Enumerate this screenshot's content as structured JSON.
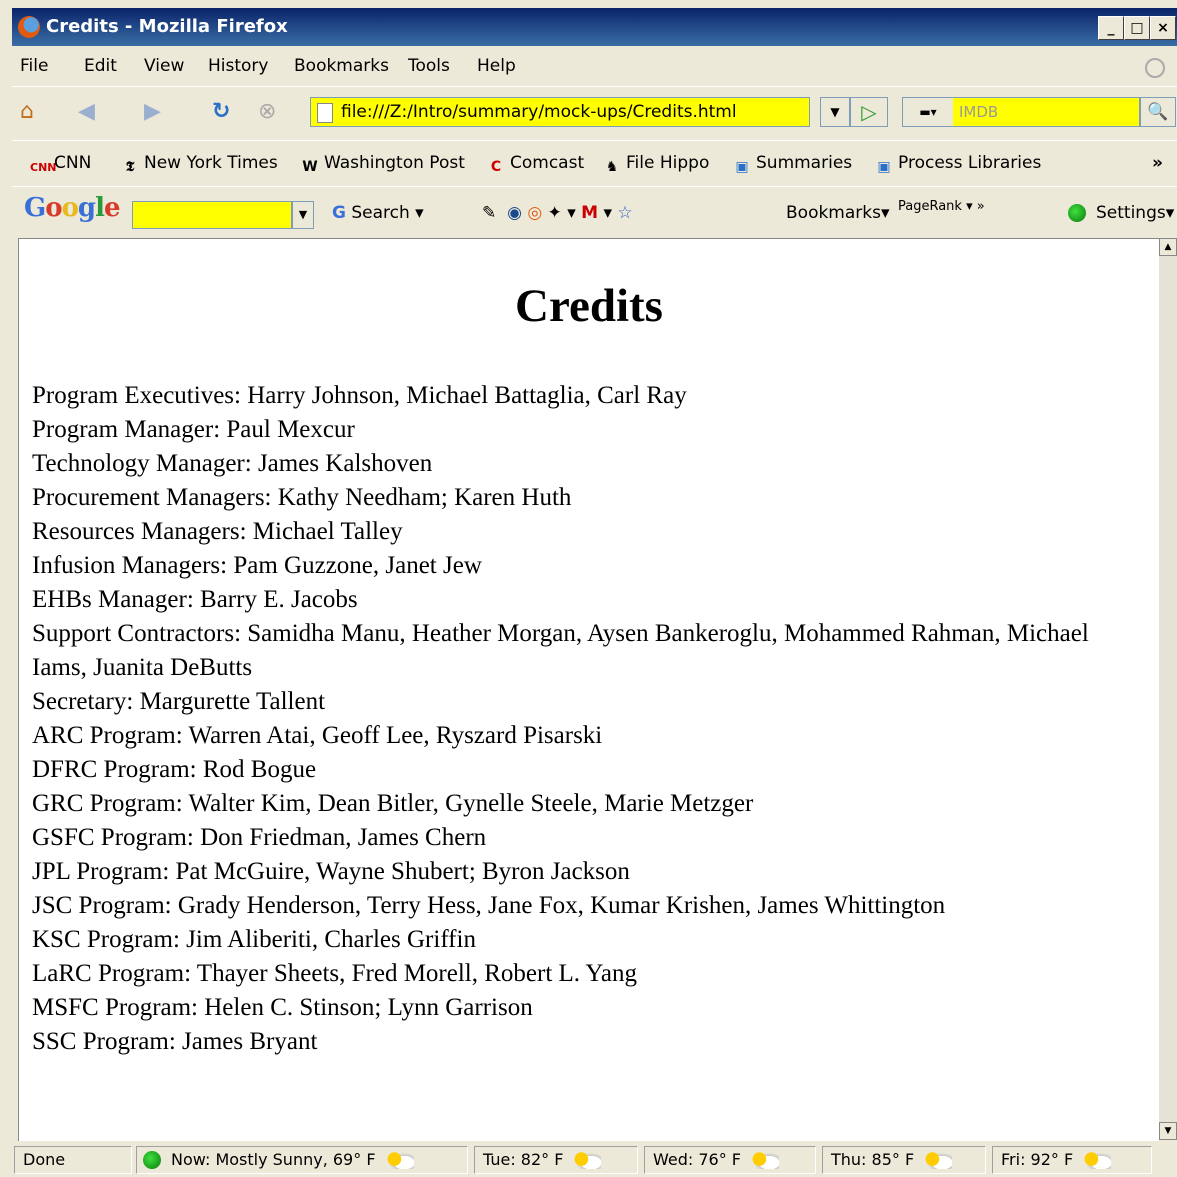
{
  "window": {
    "title": "Credits - Mozilla Firefox"
  },
  "menu": [
    "File",
    "Edit",
    "View",
    "History",
    "Bookmarks",
    "Tools",
    "Help"
  ],
  "address": {
    "url": "file:///Z:/Intro/summary/mock-ups/Credits.html"
  },
  "search": {
    "placeholder": "IMDB"
  },
  "bookmarks": [
    "CNN",
    "New York Times",
    "Washington Post",
    "Comcast",
    "File Hippo",
    "Summaries",
    "Process Libraries"
  ],
  "google_toolbar": {
    "search_label": "Search",
    "bookmarks_label": "Bookmarks",
    "pagerank_label": "PageRank",
    "settings_label": "Settings"
  },
  "page": {
    "heading": "Credits",
    "lines": [
      "Program Executives: Harry Johnson, Michael Battaglia, Carl Ray",
      "Program Manager: Paul Mexcur",
      "Technology Manager: James Kalshoven",
      "Procurement Managers: Kathy Needham; Karen Huth",
      "Resources Managers: Michael Talley",
      "Infusion Managers: Pam Guzzone, Janet Jew",
      "EHBs Manager: Barry E. Jacobs",
      "Support Contractors: Samidha Manu, Heather Morgan, Aysen Bankeroglu, Mohammed Rahman, Michael",
      "Iams, Juanita DeButts",
      "Secretary: Margurette Tallent",
      "ARC Program: Warren Atai, Geoff Lee, Ryszard Pisarski",
      "DFRC Program: Rod Bogue",
      "GRC Program: Walter Kim, Dean Bitler, Gynelle Steele, Marie Metzger",
      "GSFC Program: Don Friedman, James Chern",
      "JPL Program: Pat McGuire, Wayne Shubert; Byron Jackson",
      "JSC Program: Grady Henderson, Terry Hess, Jane Fox, Kumar Krishen, James Whittington",
      "KSC Program: Jim Aliberiti, Charles Griffin",
      "LaRC Program: Thayer Sheets, Fred Morell, Robert L. Yang",
      "MSFC Program: Helen C. Stinson; Lynn Garrison",
      "SSC Program: James Bryant"
    ]
  },
  "status": {
    "text": "Done",
    "weather": [
      "Now: Mostly Sunny, 69° F",
      "Tue: 82° F",
      "Wed: 76° F",
      "Thu: 85° F",
      "Fri: 92° F"
    ]
  }
}
